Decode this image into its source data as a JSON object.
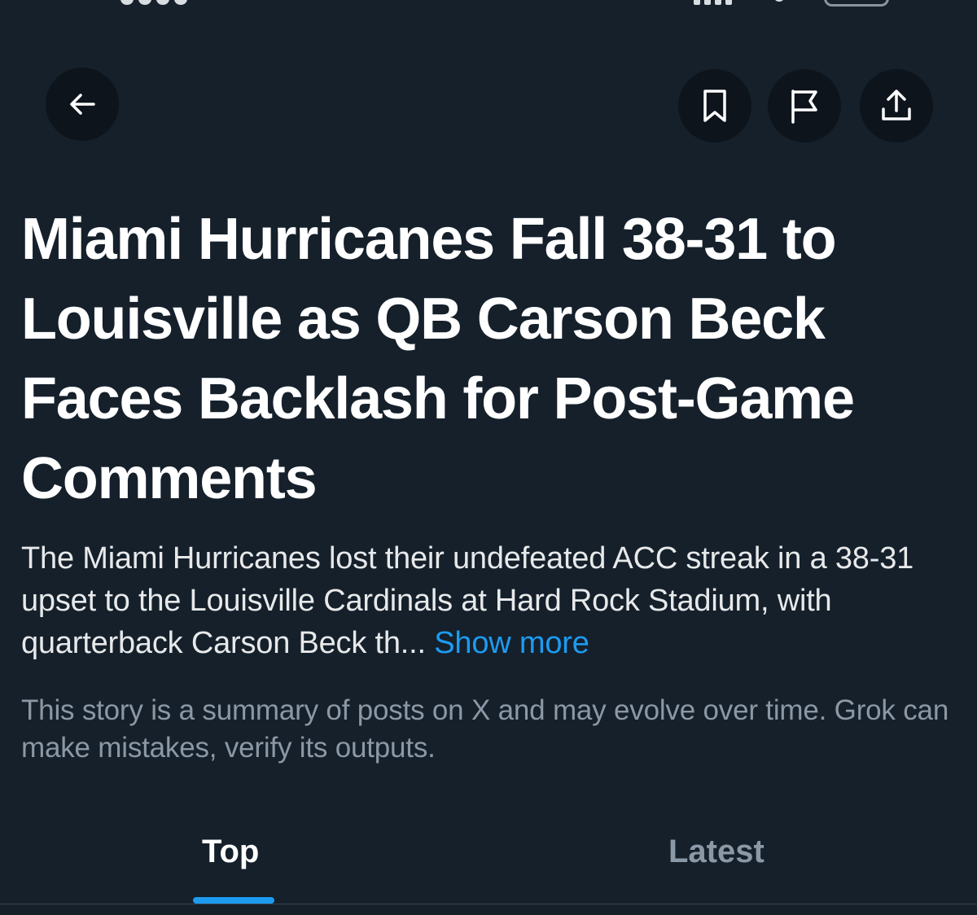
{
  "header": {
    "back_icon": "arrow-left-icon",
    "actions": [
      {
        "name": "bookmark",
        "icon": "bookmark-icon"
      },
      {
        "name": "report",
        "icon": "flag-icon"
      },
      {
        "name": "share",
        "icon": "share-icon"
      }
    ]
  },
  "article": {
    "headline": "Miami Hurricanes Fall 38-31 to Louisville as QB Carson Beck Faces Backlash for Post-Game Comments",
    "summary": "The Miami Hurricanes lost their undefeated ACC streak in a 38-31 upset to the Louisville Cardinals at Hard Rock Stadium, with quarterback Carson Beck th... ",
    "show_more": "Show more",
    "disclaimer": "This story is a summary of posts on X and may evolve over time. Grok can make mistakes, verify its outputs."
  },
  "tabs": [
    {
      "label": "Top",
      "active": true
    },
    {
      "label": "Latest",
      "active": false
    }
  ],
  "colors": {
    "background": "#15202b",
    "accent": "#1d9bf0",
    "muted_text": "#8b98a5",
    "icon_button_bg": "#0d141b"
  }
}
